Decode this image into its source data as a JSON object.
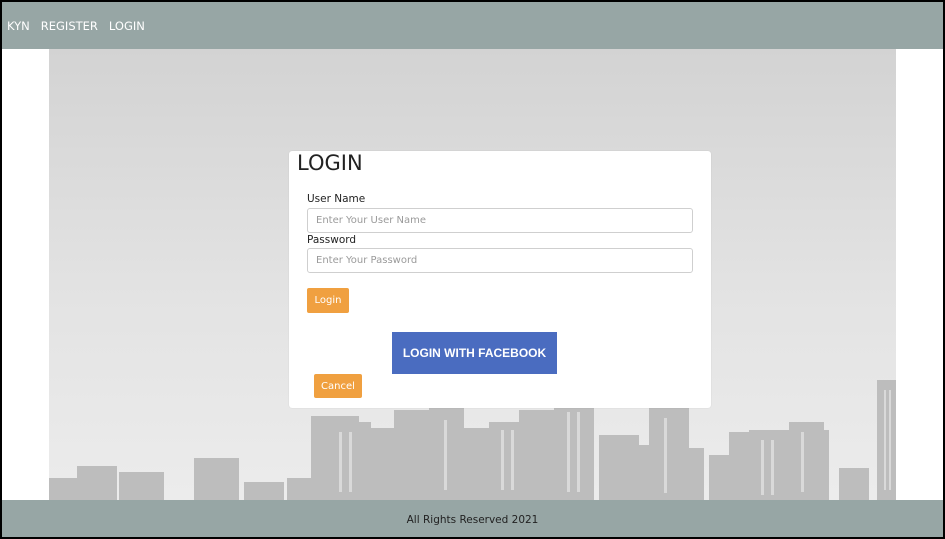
{
  "nav": {
    "brand": "KYN",
    "register": "REGISTER",
    "login": "LOGIN"
  },
  "login_form": {
    "title": "LOGIN",
    "username_label": "User Name",
    "username_placeholder": "Enter Your User Name",
    "username_value": "",
    "password_label": "Password",
    "password_placeholder": "Enter Your Password",
    "password_value": "",
    "login_button": "Login",
    "facebook_button": "LOGIN WITH FACEBOOK",
    "cancel_button": "Cancel"
  },
  "footer": {
    "text": "All Rights Reserved 2021"
  },
  "colors": {
    "nav_background": "#97a6a5",
    "button_orange": "#f0a040",
    "facebook_blue": "#4a6cc0"
  }
}
